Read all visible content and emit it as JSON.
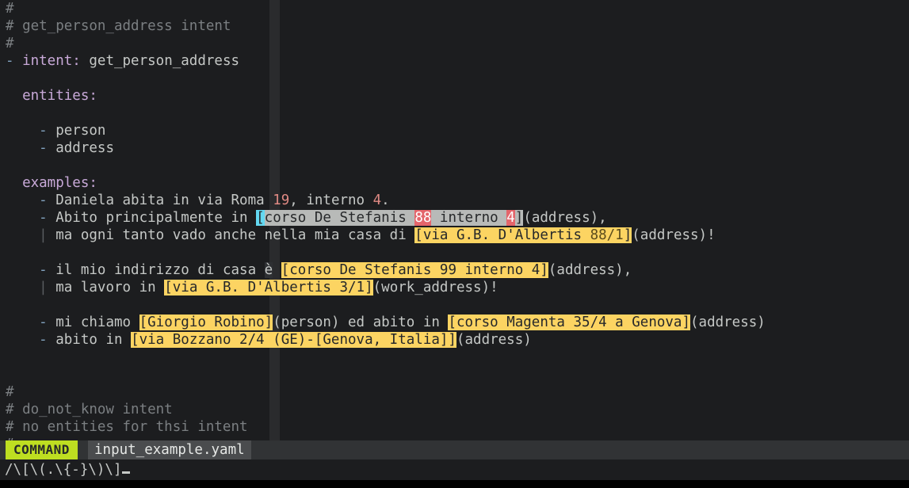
{
  "editor": {
    "background": "#1c1d1f",
    "foreground": "#c5c8c6",
    "comment_color": "#7b7f82",
    "key_color": "#c8a9d8",
    "number_color": "#e08a84",
    "search_highlight_color": "#fcd462",
    "selection_color": "#b8bab8",
    "cursor_color": "#63d8f1",
    "secondary_cursor_color": "#e4656b"
  },
  "statusline": {
    "mode": "COMMAND",
    "mode_bg": "#bede21",
    "filename": "input_example.yaml",
    "filename_bg": "#4a4c4e"
  },
  "commandline": {
    "text": "/\\[\\(.\\{-}\\)\\]",
    "cursor": "_"
  },
  "buffer": {
    "lines": [
      {
        "n": 1,
        "segments": [
          {
            "t": "#",
            "c": "comment"
          }
        ]
      },
      {
        "n": 2,
        "segments": [
          {
            "t": "# get_person_address intent",
            "c": "comment"
          }
        ]
      },
      {
        "n": 3,
        "segments": [
          {
            "t": "#",
            "c": "comment"
          }
        ]
      },
      {
        "n": 4,
        "segments": [
          {
            "t": "- ",
            "c": "dash"
          },
          {
            "t": "intent",
            "c": "key"
          },
          {
            "t": ":",
            "c": "punct"
          },
          {
            "t": " get_person_address",
            "c": "plain"
          }
        ]
      },
      {
        "n": 5,
        "segments": []
      },
      {
        "n": 6,
        "segments": [
          {
            "t": "  ",
            "c": "plain"
          },
          {
            "t": "entities",
            "c": "key"
          },
          {
            "t": ":",
            "c": "punct"
          }
        ]
      },
      {
        "n": 7,
        "segments": []
      },
      {
        "n": 8,
        "segments": [
          {
            "t": "    ",
            "c": "plain"
          },
          {
            "t": "-",
            "c": "dash"
          },
          {
            "t": " person",
            "c": "plain"
          }
        ]
      },
      {
        "n": 9,
        "segments": [
          {
            "t": "    ",
            "c": "plain"
          },
          {
            "t": "-",
            "c": "dash"
          },
          {
            "t": " address",
            "c": "plain"
          }
        ]
      },
      {
        "n": 10,
        "segments": []
      },
      {
        "n": 11,
        "segments": [
          {
            "t": "  ",
            "c": "plain"
          },
          {
            "t": "examples",
            "c": "key"
          },
          {
            "t": ":",
            "c": "punct"
          }
        ]
      },
      {
        "n": 12,
        "segments": [
          {
            "t": "    ",
            "c": "plain"
          },
          {
            "t": "-",
            "c": "dash"
          },
          {
            "t": " Daniela abita in via Roma ",
            "c": "plain"
          },
          {
            "t": "19",
            "c": "num"
          },
          {
            "t": ", interno ",
            "c": "plain"
          },
          {
            "t": "4",
            "c": "num"
          },
          {
            "t": ".",
            "c": "plain"
          }
        ]
      },
      {
        "n": 13,
        "segments": [
          {
            "t": "    ",
            "c": "plain"
          },
          {
            "t": "-",
            "c": "dash"
          },
          {
            "t": " Abito principalmente in ",
            "c": "plain"
          },
          {
            "t": "[",
            "c": "cursor-cyan"
          },
          {
            "t": "corso De Stefanis ",
            "c": "sel"
          },
          {
            "t": "88",
            "c": "cur-red"
          },
          {
            "t": " interno ",
            "c": "sel"
          },
          {
            "t": "4",
            "c": "cur-red"
          },
          {
            "t": "]",
            "c": "sel"
          },
          {
            "t": "(address),",
            "c": "paren"
          }
        ]
      },
      {
        "n": 14,
        "segments": [
          {
            "t": "    ",
            "c": "plain"
          },
          {
            "t": "|",
            "c": "bar"
          },
          {
            "t": " ma ogni tanto vado anche nella mia casa di ",
            "c": "plain"
          },
          {
            "t": "[via G.B. D'Albertis ",
            "c": "hl"
          },
          {
            "t": "88/1",
            "c": "hl-alt"
          },
          {
            "t": "]",
            "c": "hl"
          },
          {
            "t": "(address)!",
            "c": "paren"
          }
        ]
      },
      {
        "n": 15,
        "segments": []
      },
      {
        "n": 16,
        "segments": [
          {
            "t": "    ",
            "c": "plain"
          },
          {
            "t": "-",
            "c": "dash"
          },
          {
            "t": " il mio indirizzo di casa ",
            "c": "plain"
          },
          {
            "t": "è",
            "c": "chbox"
          },
          {
            "t": " ",
            "c": "plain"
          },
          {
            "t": "[corso De Stefanis 99 interno 4]",
            "c": "hl"
          },
          {
            "t": "(address),",
            "c": "paren"
          }
        ]
      },
      {
        "n": 17,
        "segments": [
          {
            "t": "    ",
            "c": "plain"
          },
          {
            "t": "|",
            "c": "bar"
          },
          {
            "t": " ma lavoro in ",
            "c": "plain"
          },
          {
            "t": "[via G.B. D'Albertis 3/1]",
            "c": "hl"
          },
          {
            "t": "(work_address)!",
            "c": "paren"
          }
        ]
      },
      {
        "n": 18,
        "segments": []
      },
      {
        "n": 19,
        "segments": [
          {
            "t": "    ",
            "c": "plain"
          },
          {
            "t": "-",
            "c": "dash"
          },
          {
            "t": " mi chiamo ",
            "c": "plain"
          },
          {
            "t": "[Giorgio Robino]",
            "c": "hl"
          },
          {
            "t": "(person) ed abito in ",
            "c": "paren"
          },
          {
            "t": "[corso Magenta 35/4 a Genova]",
            "c": "hl"
          },
          {
            "t": "(address)",
            "c": "paren"
          }
        ]
      },
      {
        "n": 20,
        "segments": [
          {
            "t": "    ",
            "c": "plain"
          },
          {
            "t": "-",
            "c": "dash"
          },
          {
            "t": " abito in ",
            "c": "plain"
          },
          {
            "t": "[via Bozzano 2/4 (GE)-[Genova, Italia]]",
            "c": "hl"
          },
          {
            "t": "(address)",
            "c": "paren"
          }
        ]
      },
      {
        "n": 21,
        "segments": []
      },
      {
        "n": 22,
        "segments": []
      },
      {
        "n": 23,
        "segments": [
          {
            "t": "#",
            "c": "comment"
          }
        ]
      },
      {
        "n": 24,
        "segments": [
          {
            "t": "# do_not_know intent",
            "c": "comment"
          }
        ]
      },
      {
        "n": 25,
        "segments": [
          {
            "t": "# no entities for thsi intent",
            "c": "comment"
          }
        ]
      },
      {
        "n": 26,
        "segments": [
          {
            "t": "#",
            "c": "comment"
          }
        ]
      }
    ]
  }
}
